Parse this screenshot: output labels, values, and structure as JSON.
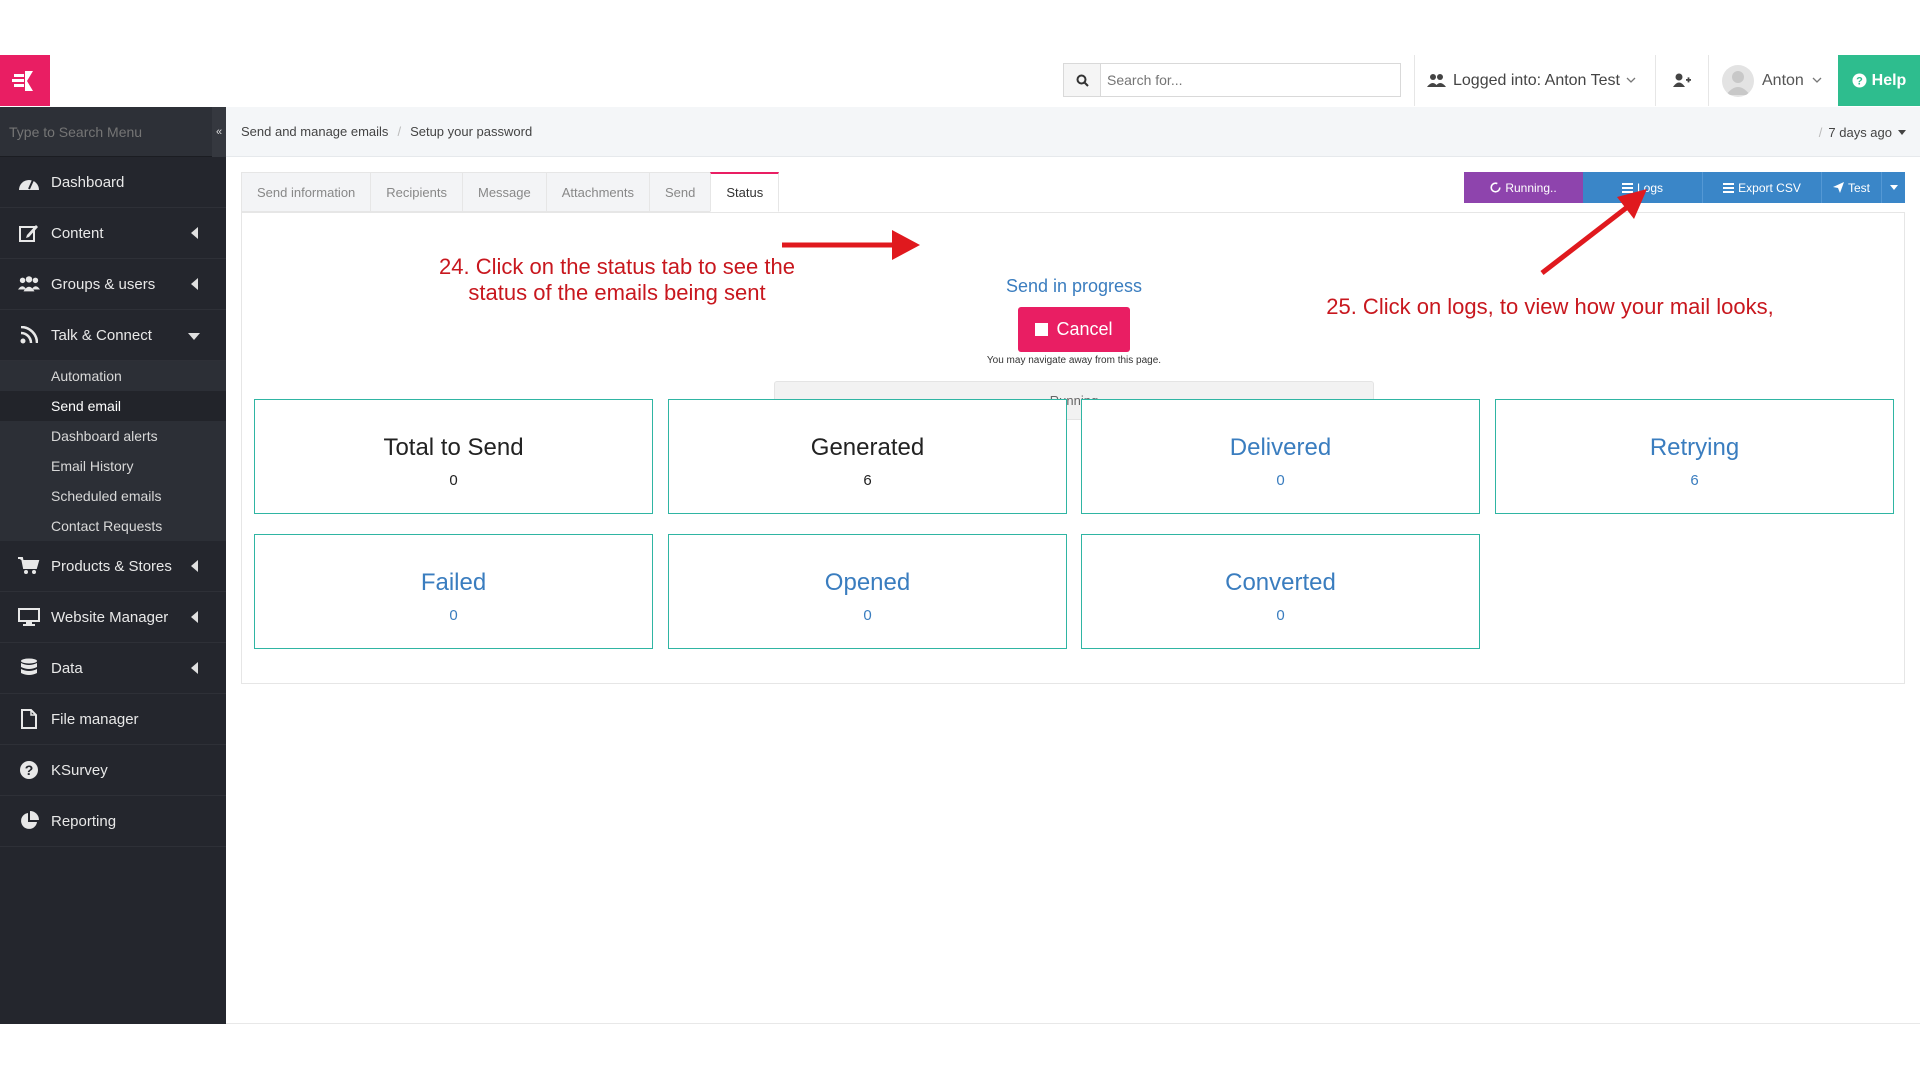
{
  "topbar": {
    "search_placeholder": "Search for...",
    "logged_into": "Logged into: Anton Test",
    "user_name": "Anton",
    "help_label": "Help"
  },
  "sidebar": {
    "search_placeholder": "Type to Search Menu",
    "items": [
      {
        "label": "Dashboard"
      },
      {
        "label": "Content"
      },
      {
        "label": "Groups & users"
      },
      {
        "label": "Talk & Connect"
      },
      {
        "label": "Products & Stores"
      },
      {
        "label": "Website Manager"
      },
      {
        "label": "Data"
      },
      {
        "label": "File manager"
      },
      {
        "label": "KSurvey"
      },
      {
        "label": "Reporting"
      }
    ],
    "sub_items": [
      {
        "label": "Automation"
      },
      {
        "label": "Send email"
      },
      {
        "label": "Dashboard alerts"
      },
      {
        "label": "Email History"
      },
      {
        "label": "Scheduled emails"
      },
      {
        "label": "Contact Requests"
      }
    ]
  },
  "breadcrumb": {
    "items": [
      "Send and manage emails",
      "Setup your password"
    ],
    "separator": "/",
    "right_sep": "/",
    "right_label": "7 days ago"
  },
  "tabs": [
    "Send information",
    "Recipients",
    "Message",
    "Attachments",
    "Send",
    "Status"
  ],
  "actions": {
    "running": "Running..",
    "logs": "Logs",
    "export": "Export CSV",
    "test": "Test"
  },
  "status": {
    "headline": "Send in progress",
    "cancel_label": "Cancel",
    "note": "You may navigate away from this page.",
    "progress_label": "Running"
  },
  "cards": [
    {
      "title": "Total to Send",
      "value": "0"
    },
    {
      "title": "Generated",
      "value": "6"
    },
    {
      "title": "Delivered",
      "value": "0"
    },
    {
      "title": "Retrying",
      "value": "6"
    },
    {
      "title": "Failed",
      "value": "0"
    },
    {
      "title": "Opened",
      "value": "0"
    },
    {
      "title": "Converted",
      "value": "0"
    }
  ],
  "annotations": {
    "step24_line1": "24. Click on the status tab to see the",
    "step24_line2": "status of the emails being sent",
    "step25": "25. Click on logs, to view how your mail looks,"
  },
  "colors": {
    "brand": "#e91e63",
    "help": "#2ebd8e",
    "running": "#8e44ad",
    "primary": "#3a86c8",
    "card_border": "#2fb5a3",
    "annotation": "#c8171e"
  }
}
